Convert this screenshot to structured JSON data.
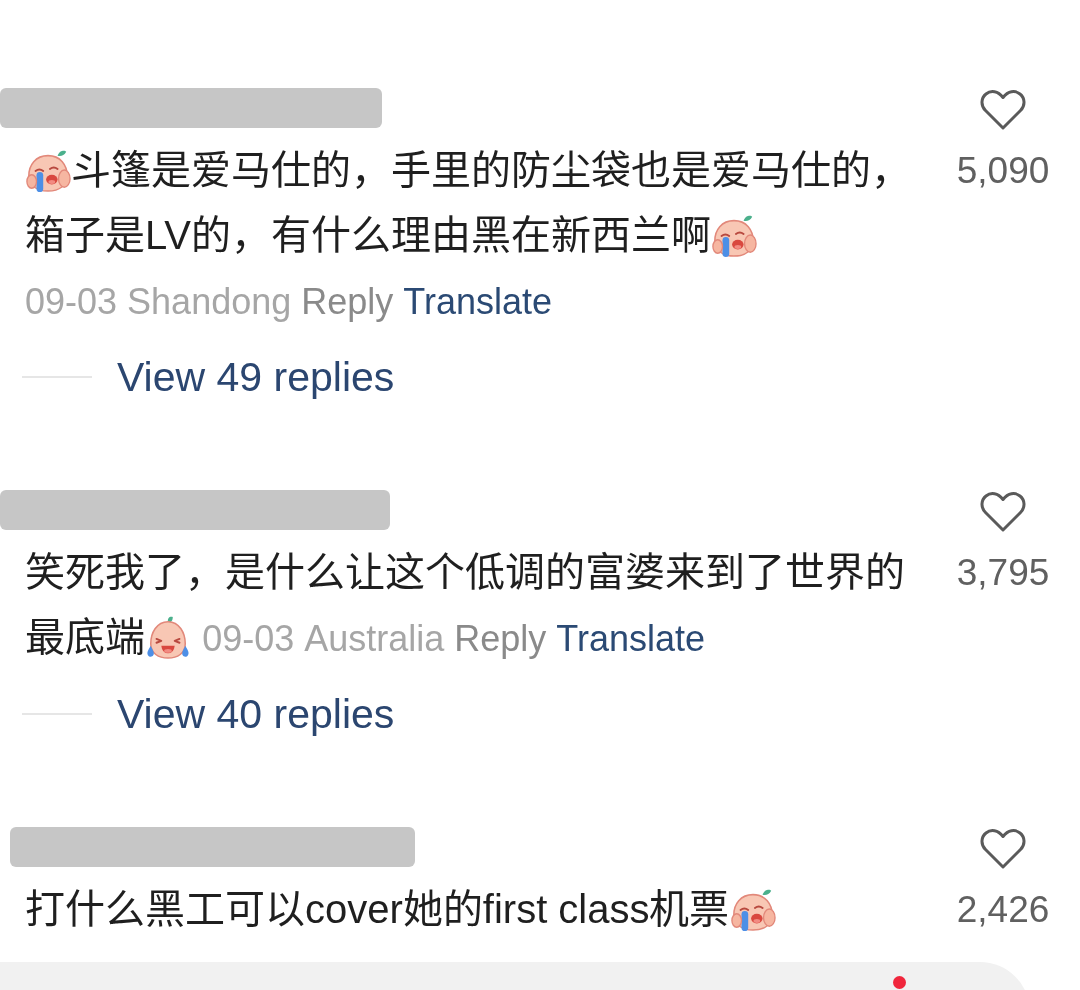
{
  "comments": [
    {
      "lines": [
        [
          {
            "kind": "crying_emoji"
          },
          {
            "kind": "text",
            "text": "斗篷是爱马仕的，手里的防尘袋也是爱马仕的，"
          }
        ],
        [
          {
            "kind": "text",
            "text": "箱子是LV的，有什么理由黑在新西兰啊"
          },
          {
            "kind": "crying_emoji"
          }
        ]
      ],
      "date": "09-03",
      "location": "Shandong",
      "reply": "Reply",
      "translate": "Translate",
      "view_replies": "View 49 replies",
      "liked": false,
      "likes": "5,090"
    },
    {
      "lines": [
        [
          {
            "kind": "text",
            "text": "笑死我了，是什么让这个低调的富婆来到了世界的"
          }
        ],
        [
          {
            "kind": "text",
            "text": "最底端"
          },
          {
            "kind": "laughing_emoji"
          }
        ]
      ],
      "date": "09-03",
      "location": "Australia",
      "reply": "Reply",
      "translate": "Translate",
      "view_replies": "View 40 replies",
      "liked": false,
      "likes": "3,795"
    },
    {
      "lines": [
        [
          {
            "kind": "text",
            "text": "打什么黑工可以cover她的first class机票"
          },
          {
            "kind": "crying_emoji"
          }
        ]
      ],
      "liked": false,
      "likes": "2,426"
    }
  ]
}
